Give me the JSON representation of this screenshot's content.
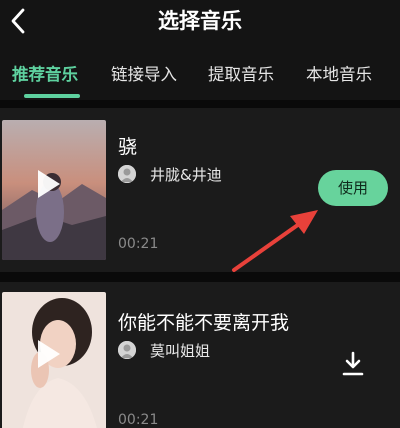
{
  "header": {
    "title": "选择音乐",
    "back_icon": "chevron-left-icon"
  },
  "tabs": [
    {
      "label": "推荐音乐",
      "active": true
    },
    {
      "label": "链接导入",
      "active": false
    },
    {
      "label": "提取音乐",
      "active": false
    },
    {
      "label": "本地音乐",
      "active": false
    }
  ],
  "songs": [
    {
      "title": "骁",
      "artist": "井胧&井迪",
      "duration": "00:21",
      "action_label": "使用"
    },
    {
      "title": "你能不能不要离开我",
      "artist": "莫叫姐姐",
      "duration": "00:21",
      "action_icon": "download-icon"
    }
  ],
  "colors": {
    "accent": "#5ed19f",
    "button": "#67d39c",
    "annotation_arrow": "#e8413a",
    "background": "#121212"
  }
}
